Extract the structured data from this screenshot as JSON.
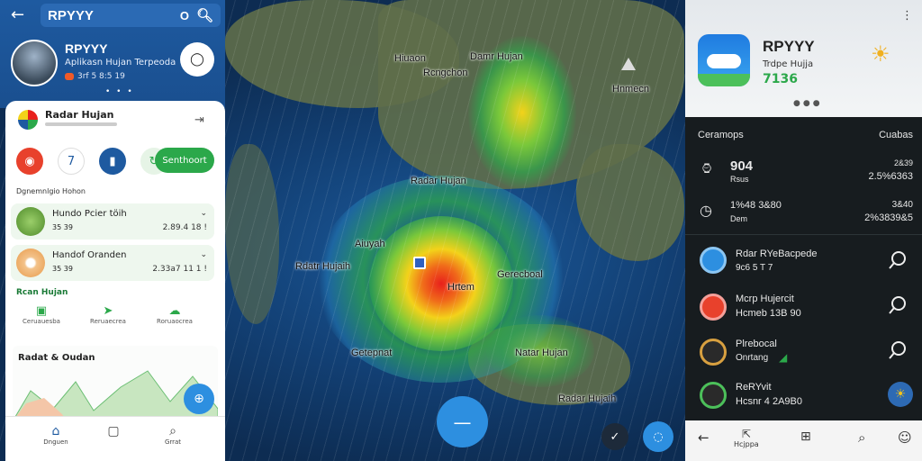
{
  "search": {
    "query": "RPYYY",
    "right_glyph": "O"
  },
  "left_panel": {
    "app_title": "RPYYY",
    "subtitle": "Aplikasn Hujan Terpeoda",
    "meta": "3rf 5 8:5 19",
    "card_title": "Radar Hujan",
    "chips": [
      "7",
      "Senthoort"
    ],
    "section_label": "Dgnemnlgio Hohon",
    "items": [
      {
        "title": "Hundo Pcier töih",
        "sub": "35 39",
        "right": "2.89.4 18 !"
      },
      {
        "title": "Handof Oranden",
        "sub": "35 39",
        "right": "2.33a7 11 1 !"
      }
    ],
    "section2": "Rcan Hujan",
    "features": [
      "Ceruauesba",
      "Reruaecrea",
      "Roruaocrea"
    ],
    "chart_title": "Radat & Oudan",
    "nav": [
      "Dnguen",
      "",
      "Grrat"
    ]
  },
  "map": {
    "labels": [
      "Hiuaon",
      "Rcngchon",
      "Damr Hujan",
      "Hnmecn",
      "Radar Hujan",
      "Aiuyah",
      "Rdatr Hujaih",
      "Hrtem",
      "Gerecboal",
      "Getepnat",
      "Natar Hujan",
      "Radar Hujaih"
    ],
    "fab_main": "—"
  },
  "right_panel": {
    "title": "RPYYY",
    "subtitle": "Trdpe Hujja",
    "value": "7136",
    "header_left": "Ceramops",
    "header_right": "Cuabas",
    "stats": [
      {
        "big": "904",
        "small": "Rsus",
        "right1": "2&39",
        "right2": "2.5%6363"
      },
      {
        "big": "1%48 3&80",
        "small": "Dem",
        "right1": "3&40",
        "right2": "2%3839&5"
      }
    ],
    "list": [
      {
        "title": "Rdar RYeBacpede",
        "sub": "9c6 5 T 7"
      },
      {
        "title": "Mcrp Hujercit",
        "sub": "Hcmeb 13B 90"
      },
      {
        "title": "Plrebocal",
        "sub": "Onrtang"
      },
      {
        "title": "ReRYvit",
        "sub": "Hcsnr 4 2A9B0"
      }
    ],
    "nav": [
      "",
      "Hcjppa",
      "",
      "",
      ""
    ]
  },
  "colors": {
    "accent": "#1e5aa0",
    "green": "#2ba84a",
    "radar_core": "#e8201c",
    "radar_outer": "#2ea84a"
  }
}
